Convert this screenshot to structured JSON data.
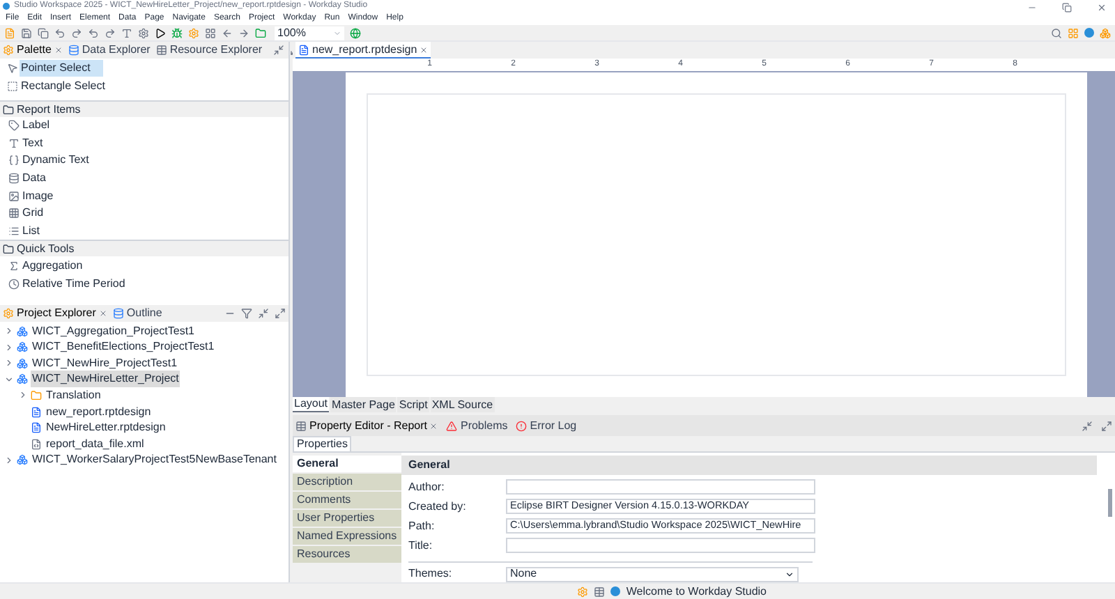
{
  "window": {
    "title": "Studio Workspace 2025 - WICT_NewHireLetter_Project/new_report.rptdesign - Workday Studio"
  },
  "menu": [
    "File",
    "Edit",
    "Insert",
    "Element",
    "Data",
    "Page",
    "Navigate",
    "Search",
    "Project",
    "Workday",
    "Run",
    "Window",
    "Help"
  ],
  "toolbar": {
    "zoom": "100%"
  },
  "palette": {
    "tabs": [
      {
        "label": "Palette",
        "selected": true
      },
      {
        "label": "Data Explorer",
        "selected": false
      },
      {
        "label": "Resource Explorer",
        "selected": false
      }
    ],
    "tools": [
      {
        "label": "Pointer Select",
        "selected": true
      },
      {
        "label": "Rectangle Select",
        "selected": false
      }
    ],
    "sections": [
      {
        "title": "Report Items",
        "items": [
          "Label",
          "Text",
          "Dynamic Text",
          "Data",
          "Image",
          "Grid",
          "List"
        ]
      },
      {
        "title": "Quick Tools",
        "items": [
          "Aggregation",
          "Relative Time Period"
        ]
      }
    ]
  },
  "project_explorer": {
    "tabs": [
      {
        "label": "Project Explorer",
        "selected": true
      },
      {
        "label": "Outline",
        "selected": false
      }
    ],
    "tree": [
      {
        "label": "WICT_Aggregation_ProjectTest1",
        "kind": "project",
        "expanded": false,
        "selected": false
      },
      {
        "label": "WICT_BenefitElections_ProjectTest1",
        "kind": "project",
        "expanded": false,
        "selected": false
      },
      {
        "label": "WICT_NewHire_ProjectTest1",
        "kind": "project",
        "expanded": false,
        "selected": false
      },
      {
        "label": "WICT_NewHireLetter_Project",
        "kind": "project",
        "expanded": true,
        "selected": true,
        "children": [
          {
            "label": "Translation",
            "kind": "folder",
            "expanded": false,
            "selected": false
          },
          {
            "label": "new_report.rptdesign",
            "kind": "report",
            "selected": false
          },
          {
            "label": "NewHireLetter.rptdesign",
            "kind": "report",
            "selected": false
          },
          {
            "label": "report_data_file.xml",
            "kind": "xml",
            "selected": false
          }
        ]
      },
      {
        "label": "WICT_WorkerSalaryProjectTest5NewBaseTenant",
        "kind": "project",
        "expanded": false,
        "selected": false
      }
    ]
  },
  "editor": {
    "tabs": [
      {
        "label": "new_report.rptdesign",
        "selected": true
      }
    ],
    "ruler": [
      "1",
      "2",
      "3",
      "4",
      "5",
      "6",
      "7",
      "8"
    ],
    "view_tabs": [
      {
        "label": "Layout",
        "selected": true
      },
      {
        "label": "Master Page",
        "selected": false
      },
      {
        "label": "Script",
        "selected": false
      },
      {
        "label": "XML Source",
        "selected": false
      }
    ]
  },
  "property_editor": {
    "tabs": [
      {
        "label": "Property Editor - Report",
        "selected": true
      },
      {
        "label": "Problems",
        "selected": false
      },
      {
        "label": "Error Log",
        "selected": false
      }
    ],
    "sub_tab": "Properties",
    "categories": [
      {
        "label": "General",
        "selected": true
      },
      {
        "label": "Description",
        "selected": false
      },
      {
        "label": "Comments",
        "selected": false
      },
      {
        "label": "User Properties",
        "selected": false
      },
      {
        "label": "Named Expressions",
        "selected": false
      },
      {
        "label": "Resources",
        "selected": false
      }
    ],
    "section_title": "General",
    "fields": [
      {
        "label": "Author:",
        "kind": "text"
      },
      {
        "label": "Created by:",
        "kind": "text",
        "value": "Eclipse BIRT Designer Version 4.15.0.13-WORKDAY"
      },
      {
        "label": "Path:",
        "kind": "text",
        "value": "C:\\Users\\emma.lybrand\\Studio Workspace 2025\\WICT_NewHire"
      },
      {
        "label": "Title:",
        "kind": "text"
      },
      {
        "label": "Themes:",
        "kind": "select",
        "value": "None"
      }
    ]
  },
  "status_bar": {
    "message": "Welcome to Workday Studio"
  }
}
